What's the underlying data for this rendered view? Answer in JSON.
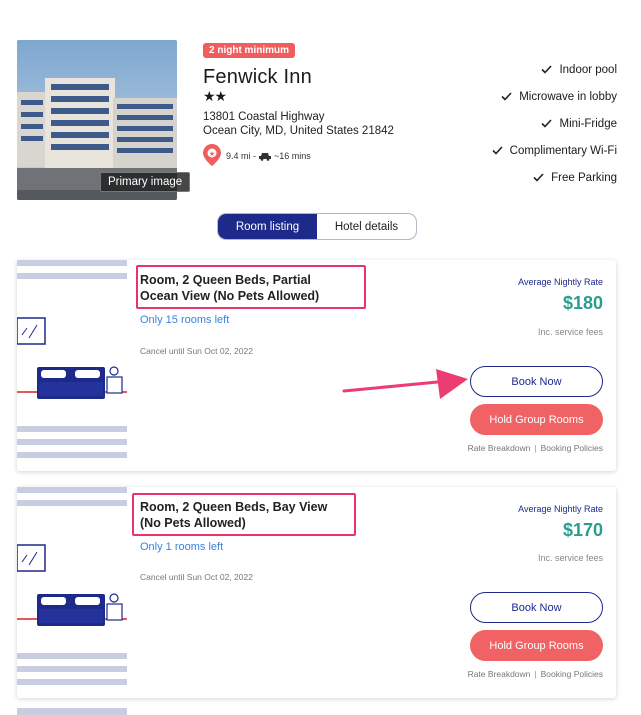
{
  "hotel": {
    "photo_caption": "Primary image",
    "min_stay_badge": "2 night minimum",
    "name": "Fenwick Inn",
    "stars": "★★",
    "address_line1": "13801 Coastal Highway",
    "address_line2": "Ocean City, MD, United States 21842",
    "distance": "9.4 mi -",
    "drive_time": "~16 mins",
    "amenities": [
      "Indoor pool",
      "Microwave in lobby",
      "Mini-Fridge",
      "Complimentary Wi-Fi",
      "Free Parking"
    ]
  },
  "tabs": [
    "Room listing",
    "Hotel details"
  ],
  "rooms": [
    {
      "title": "Room, 2 Queen Beds, Partial Ocean View (No Pets Allowed)",
      "availability": "Only 15 rooms left",
      "cancel_policy": "Cancel until Sun Oct 02, 2022",
      "rate_label": "Average Nightly Rate",
      "price": "$180",
      "fees_note": "Inc. service fees",
      "book_label": "Book Now",
      "hold_label": "Hold Group Rooms",
      "rate_breakdown": "Rate Breakdown",
      "booking_policies": "Booking Policies"
    },
    {
      "title": "Room, 2 Queen Beds, Bay View (No Pets Allowed)",
      "availability": "Only 1 rooms left",
      "cancel_policy": "Cancel until Sun Oct 02, 2022",
      "rate_label": "Average Nightly Rate",
      "price": "$170",
      "fees_note": "Inc. service fees",
      "book_label": "Book Now",
      "hold_label": "Hold Group Rooms",
      "rate_breakdown": "Rate Breakdown",
      "booking_policies": "Booking Policies"
    }
  ],
  "separator": "|",
  "colors": {
    "brand_navy": "#1d2a8a",
    "accent_coral": "#f06263",
    "price_teal": "#2a9d8f",
    "annotation_pink": "#e8336d",
    "availability_blue": "#3a82e0"
  }
}
